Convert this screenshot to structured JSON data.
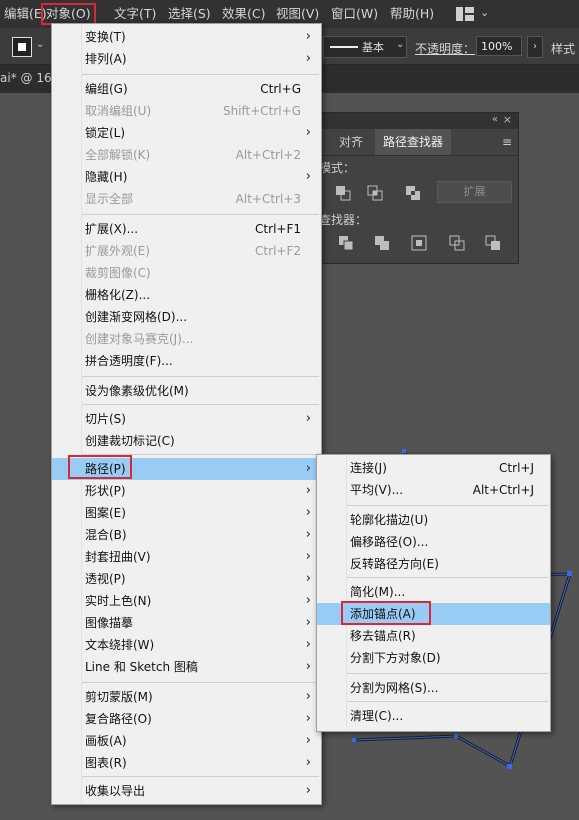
{
  "menubar": {
    "items": [
      "编辑(E)",
      "对象(O)",
      "文字(T)",
      "选择(S)",
      "效果(C)",
      "视图(V)",
      "窗口(W)",
      "帮助(H)"
    ]
  },
  "toolbar": {
    "stroke_style": "基本",
    "opacity_label": "不透明度：",
    "opacity_value": "100%",
    "style_label": "样式"
  },
  "tab": {
    "title": "ai* @ 16"
  },
  "object_menu": {
    "items": [
      {
        "label": "变换(T)",
        "shortcut": "",
        "submenu": true,
        "disabled": false
      },
      {
        "label": "排列(A)",
        "shortcut": "",
        "submenu": true,
        "disabled": false
      },
      {
        "label": "编组(G)",
        "shortcut": "Ctrl+G",
        "submenu": false,
        "disabled": false
      },
      {
        "label": "取消编组(U)",
        "shortcut": "Shift+Ctrl+G",
        "submenu": false,
        "disabled": true
      },
      {
        "label": "锁定(L)",
        "shortcut": "",
        "submenu": true,
        "disabled": false
      },
      {
        "label": "全部解锁(K)",
        "shortcut": "Alt+Ctrl+2",
        "submenu": false,
        "disabled": true
      },
      {
        "label": "隐藏(H)",
        "shortcut": "",
        "submenu": true,
        "disabled": false
      },
      {
        "label": "显示全部",
        "shortcut": "Alt+Ctrl+3",
        "submenu": false,
        "disabled": true
      },
      {
        "label": "扩展(X)...",
        "shortcut": "Ctrl+F1",
        "submenu": false,
        "disabled": false
      },
      {
        "label": "扩展外观(E)",
        "shortcut": "Ctrl+F2",
        "submenu": false,
        "disabled": true
      },
      {
        "label": "裁剪图像(C)",
        "shortcut": "",
        "submenu": false,
        "disabled": true
      },
      {
        "label": "栅格化(Z)...",
        "shortcut": "",
        "submenu": false,
        "disabled": false
      },
      {
        "label": "创建渐变网格(D)...",
        "shortcut": "",
        "submenu": false,
        "disabled": false
      },
      {
        "label": "创建对象马赛克(J)...",
        "shortcut": "",
        "submenu": false,
        "disabled": true
      },
      {
        "label": "拼合透明度(F)...",
        "shortcut": "",
        "submenu": false,
        "disabled": false
      },
      {
        "label": "设为像素级优化(M)",
        "shortcut": "",
        "submenu": false,
        "disabled": false
      },
      {
        "label": "切片(S)",
        "shortcut": "",
        "submenu": true,
        "disabled": false
      },
      {
        "label": "创建裁切标记(C)",
        "shortcut": "",
        "submenu": false,
        "disabled": false
      },
      {
        "label": "路径(P)",
        "shortcut": "",
        "submenu": true,
        "disabled": false
      },
      {
        "label": "形状(P)",
        "shortcut": "",
        "submenu": true,
        "disabled": false
      },
      {
        "label": "图案(E)",
        "shortcut": "",
        "submenu": true,
        "disabled": false
      },
      {
        "label": "混合(B)",
        "shortcut": "",
        "submenu": true,
        "disabled": false
      },
      {
        "label": "封套扭曲(V)",
        "shortcut": "",
        "submenu": true,
        "disabled": false
      },
      {
        "label": "透视(P)",
        "shortcut": "",
        "submenu": true,
        "disabled": false
      },
      {
        "label": "实时上色(N)",
        "shortcut": "",
        "submenu": true,
        "disabled": false
      },
      {
        "label": "图像描摹",
        "shortcut": "",
        "submenu": true,
        "disabled": false
      },
      {
        "label": "文本绕排(W)",
        "shortcut": "",
        "submenu": true,
        "disabled": false
      },
      {
        "label": "Line 和 Sketch 图稿",
        "shortcut": "",
        "submenu": true,
        "disabled": false
      },
      {
        "label": "剪切蒙版(M)",
        "shortcut": "",
        "submenu": true,
        "disabled": false
      },
      {
        "label": "复合路径(O)",
        "shortcut": "",
        "submenu": true,
        "disabled": false
      },
      {
        "label": "画板(A)",
        "shortcut": "",
        "submenu": true,
        "disabled": false
      },
      {
        "label": "图表(R)",
        "shortcut": "",
        "submenu": true,
        "disabled": false
      },
      {
        "label": "收集以导出",
        "shortcut": "",
        "submenu": true,
        "disabled": false
      }
    ]
  },
  "path_submenu": {
    "items": [
      {
        "label": "连接(J)",
        "shortcut": "Ctrl+J"
      },
      {
        "label": "平均(V)...",
        "shortcut": "Alt+Ctrl+J"
      },
      {
        "label": "轮廓化描边(U)",
        "shortcut": ""
      },
      {
        "label": "偏移路径(O)...",
        "shortcut": ""
      },
      {
        "label": "反转路径方向(E)",
        "shortcut": ""
      },
      {
        "label": "简化(M)...",
        "shortcut": ""
      },
      {
        "label": "添加锚点(A)",
        "shortcut": ""
      },
      {
        "label": "移去锚点(R)",
        "shortcut": ""
      },
      {
        "label": "分割下方对象(D)",
        "shortcut": ""
      },
      {
        "label": "分割为网格(S)...",
        "shortcut": ""
      },
      {
        "label": "清理(C)...",
        "shortcut": ""
      }
    ]
  },
  "pathfinder_panel": {
    "tabs": [
      "对齐",
      "路径查找器"
    ],
    "shape_modes_label": "模式：",
    "pathfinders_label": "查找器：",
    "expand_label": "扩展"
  }
}
